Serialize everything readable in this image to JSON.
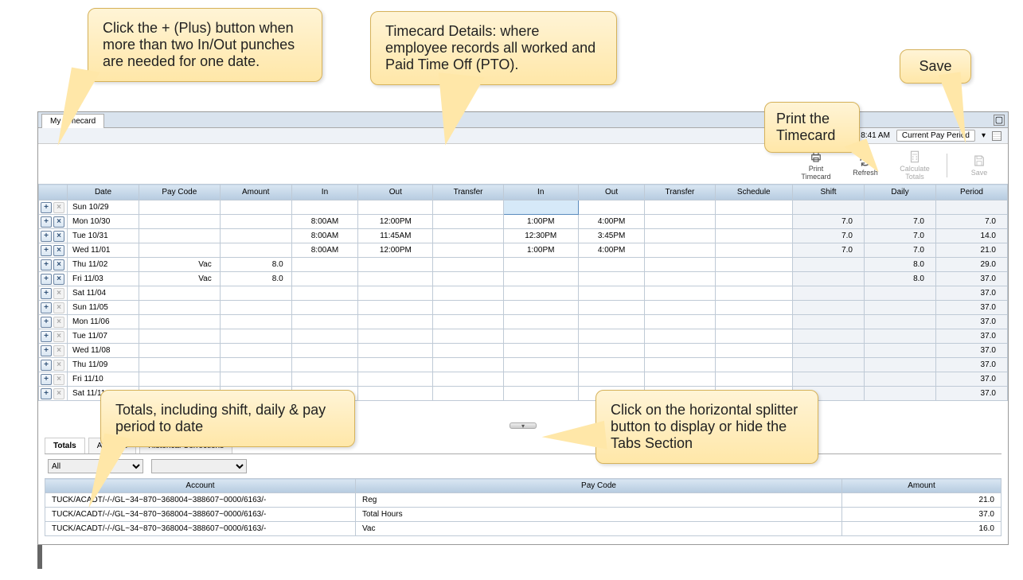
{
  "tab_title": "My Timecard",
  "topbar": {
    "loaded_label": "Loaded: 8:41 AM",
    "period_select": "Current Pay Period"
  },
  "toolbar": {
    "print_label": "Print Timecard",
    "refresh_label": "Refresh",
    "calc_label": "Calculate Totals",
    "save_label": "Save"
  },
  "columns": [
    "",
    "Date",
    "Pay Code",
    "Amount",
    "In",
    "Out",
    "Transfer",
    "In",
    "Out",
    "Transfer",
    "Schedule",
    "Shift",
    "Daily",
    "Period"
  ],
  "rows": [
    {
      "xen": false,
      "date": "Sun 10/29",
      "pc": "",
      "amt": "",
      "in1": "",
      "out1": "",
      "tr1": "",
      "in2": "",
      "out2": "",
      "tr2": "",
      "sch": "",
      "shift": "",
      "daily": "",
      "period": "",
      "sel": true
    },
    {
      "xen": true,
      "date": "Mon 10/30",
      "pc": "",
      "amt": "",
      "in1": "8:00AM",
      "out1": "12:00PM",
      "tr1": "",
      "in2": "1:00PM",
      "out2": "4:00PM",
      "tr2": "",
      "sch": "",
      "shift": "7.0",
      "daily": "7.0",
      "period": "7.0"
    },
    {
      "xen": true,
      "date": "Tue 10/31",
      "pc": "",
      "amt": "",
      "in1": "8:00AM",
      "out1": "11:45AM",
      "tr1": "",
      "in2": "12:30PM",
      "out2": "3:45PM",
      "tr2": "",
      "sch": "",
      "shift": "7.0",
      "daily": "7.0",
      "period": "14.0"
    },
    {
      "xen": true,
      "date": "Wed 11/01",
      "pc": "",
      "amt": "",
      "in1": "8:00AM",
      "out1": "12:00PM",
      "tr1": "",
      "in2": "1:00PM",
      "out2": "4:00PM",
      "tr2": "",
      "sch": "",
      "shift": "7.0",
      "daily": "7.0",
      "period": "21.0"
    },
    {
      "xen": true,
      "date": "Thu 11/02",
      "pc": "Vac",
      "amt": "8.0",
      "in1": "",
      "out1": "",
      "tr1": "",
      "in2": "",
      "out2": "",
      "tr2": "",
      "sch": "",
      "shift": "",
      "daily": "8.0",
      "period": "29.0"
    },
    {
      "xen": true,
      "date": "Fri 11/03",
      "pc": "Vac",
      "amt": "8.0",
      "in1": "",
      "out1": "",
      "tr1": "",
      "in2": "",
      "out2": "",
      "tr2": "",
      "sch": "",
      "shift": "",
      "daily": "8.0",
      "period": "37.0"
    },
    {
      "xen": false,
      "date": "Sat 11/04",
      "pc": "",
      "amt": "",
      "in1": "",
      "out1": "",
      "tr1": "",
      "in2": "",
      "out2": "",
      "tr2": "",
      "sch": "",
      "shift": "",
      "daily": "",
      "period": "37.0"
    },
    {
      "xen": false,
      "date": "Sun 11/05",
      "pc": "",
      "amt": "",
      "in1": "",
      "out1": "",
      "tr1": "",
      "in2": "",
      "out2": "",
      "tr2": "",
      "sch": "",
      "shift": "",
      "daily": "",
      "period": "37.0"
    },
    {
      "xen": false,
      "date": "Mon 11/06",
      "pc": "",
      "amt": "",
      "in1": "",
      "out1": "",
      "tr1": "",
      "in2": "",
      "out2": "",
      "tr2": "",
      "sch": "",
      "shift": "",
      "daily": "",
      "period": "37.0"
    },
    {
      "xen": false,
      "date": "Tue 11/07",
      "pc": "",
      "amt": "",
      "in1": "",
      "out1": "",
      "tr1": "",
      "in2": "",
      "out2": "",
      "tr2": "",
      "sch": "",
      "shift": "",
      "daily": "",
      "period": "37.0"
    },
    {
      "xen": false,
      "date": "Wed 11/08",
      "pc": "",
      "amt": "",
      "in1": "",
      "out1": "",
      "tr1": "",
      "in2": "",
      "out2": "",
      "tr2": "",
      "sch": "",
      "shift": "",
      "daily": "",
      "period": "37.0"
    },
    {
      "xen": false,
      "date": "Thu 11/09",
      "pc": "",
      "amt": "",
      "in1": "",
      "out1": "",
      "tr1": "",
      "in2": "",
      "out2": "",
      "tr2": "",
      "sch": "",
      "shift": "",
      "daily": "",
      "period": "37.0"
    },
    {
      "xen": false,
      "date": "Fri 11/10",
      "pc": "",
      "amt": "",
      "in1": "",
      "out1": "",
      "tr1": "",
      "in2": "",
      "out2": "",
      "tr2": "",
      "sch": "",
      "shift": "",
      "daily": "",
      "period": "37.0"
    },
    {
      "xen": false,
      "date": "Sat 11/11",
      "pc": "",
      "amt": "",
      "in1": "",
      "out1": "",
      "tr1": "",
      "in2": "",
      "out2": "",
      "tr2": "",
      "sch": "",
      "shift": "",
      "daily": "",
      "period": "37.0"
    }
  ],
  "tabs2": {
    "totals": "Totals",
    "accruals": "Accruals",
    "historical": "Historical Corrections"
  },
  "filters": {
    "all": "All",
    "opt2": ""
  },
  "totals_cols": [
    "Account",
    "Pay Code",
    "Amount"
  ],
  "totals_rows": [
    {
      "acct": "TUCK/ACADT/-/-/GL~34~870~368004~388607~0000/6163/-",
      "pc": "Reg",
      "amt": "21.0"
    },
    {
      "acct": "TUCK/ACADT/-/-/GL~34~870~368004~388607~0000/6163/-",
      "pc": "Total Hours",
      "amt": "37.0"
    },
    {
      "acct": "TUCK/ACADT/-/-/GL~34~870~368004~388607~0000/6163/-",
      "pc": "Vac",
      "amt": "16.0"
    }
  ],
  "callouts": {
    "c1": "Click the + (Plus) button when more than two In/Out punches are needed for one date.",
    "c2": "Timecard Details: where employee records all worked and Paid Time Off (PTO).",
    "c3": "Print the Timecard",
    "c4": "Save",
    "c5": "Totals, including shift, daily & pay period to date",
    "c6": "Click on the horizontal splitter button to display or hide the Tabs Section"
  }
}
